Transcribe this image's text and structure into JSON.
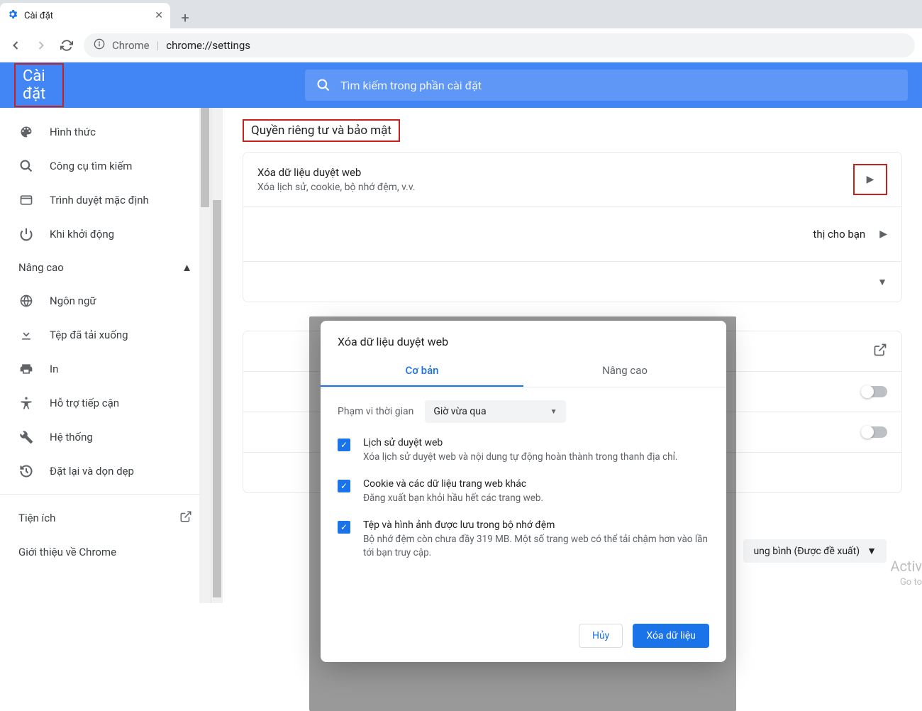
{
  "browser": {
    "tab_title": "Cài đặt",
    "url_prefix": "Chrome",
    "url_path": "chrome://settings"
  },
  "header": {
    "title": "Cài đặt",
    "search_placeholder": "Tìm kiếm trong phần cài đặt"
  },
  "sidebar": {
    "items": [
      {
        "label": "Hình thức",
        "icon": "palette"
      },
      {
        "label": "Công cụ tìm kiếm",
        "icon": "search"
      },
      {
        "label": "Trình duyệt mặc định",
        "icon": "browser"
      },
      {
        "label": "Khi khởi động",
        "icon": "power"
      }
    ],
    "advanced_label": "Nâng cao",
    "advanced_items": [
      {
        "label": "Ngôn ngữ",
        "icon": "globe"
      },
      {
        "label": "Tệp đã tải xuống",
        "icon": "download"
      },
      {
        "label": "In",
        "icon": "print"
      },
      {
        "label": "Hỗ trợ tiếp cận",
        "icon": "accessibility"
      },
      {
        "label": "Hệ thống",
        "icon": "wrench"
      },
      {
        "label": "Đặt lại và dọn dẹp",
        "icon": "restore"
      }
    ],
    "extensions_label": "Tiện ích",
    "about_label": "Giới thiệu về Chrome"
  },
  "content": {
    "section_title": "Quyền riêng tư và bảo mật",
    "rows": [
      {
        "title": "Xóa dữ liệu duyệt web",
        "sub": "Xóa lịch sử, cookie, bộ nhớ đệm, v.v."
      }
    ],
    "partial_row_suffix": "thị cho bạn",
    "recommended_option": "ung bình (Được đề xuất)"
  },
  "dialog": {
    "title": "Xóa dữ liệu duyệt web",
    "tab_basic": "Cơ bản",
    "tab_advanced": "Nâng cao",
    "range_label": "Phạm vi thời gian",
    "range_value": "Giờ vừa qua",
    "items": [
      {
        "title": "Lịch sử duyệt web",
        "sub": "Xóa lịch sử duyệt web và nội dung tự động hoàn thành trong thanh địa chỉ."
      },
      {
        "title": "Cookie và các dữ liệu trang web khác",
        "sub": "Đăng xuất bạn khỏi hầu hết các trang web."
      },
      {
        "title": "Tệp và hình ảnh được lưu trong bộ nhớ đệm",
        "sub": "Bộ nhớ đệm còn chưa đầy 319 MB. Một số trang web có thể tải chậm hơn vào lần tới bạn truy cập."
      }
    ],
    "cancel": "Hủy",
    "confirm": "Xóa dữ liệu"
  },
  "watermark": {
    "line1": "Activ",
    "line2": "Go to"
  }
}
